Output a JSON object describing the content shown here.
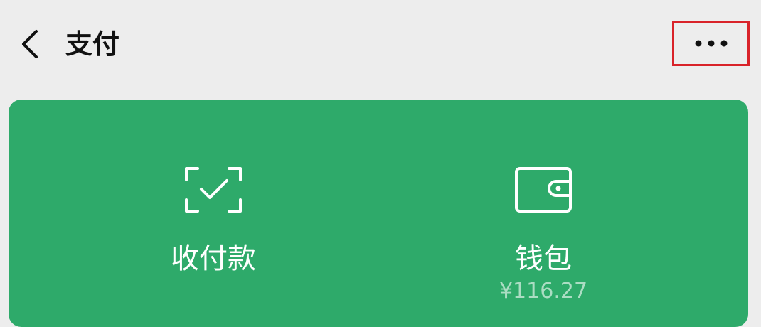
{
  "header": {
    "title": "支付",
    "back_icon": "chevron-left-icon",
    "more_icon": "more-horizontal-icon"
  },
  "card": {
    "background": "#2eaa6a",
    "actions": [
      {
        "label": "收付款",
        "icon": "scan-check-icon"
      },
      {
        "label": "钱包",
        "icon": "wallet-icon",
        "balance": "¥116.27"
      }
    ]
  },
  "colors": {
    "page_background": "#ededed",
    "highlight_border": "#d9232a",
    "text_primary": "#111111"
  }
}
